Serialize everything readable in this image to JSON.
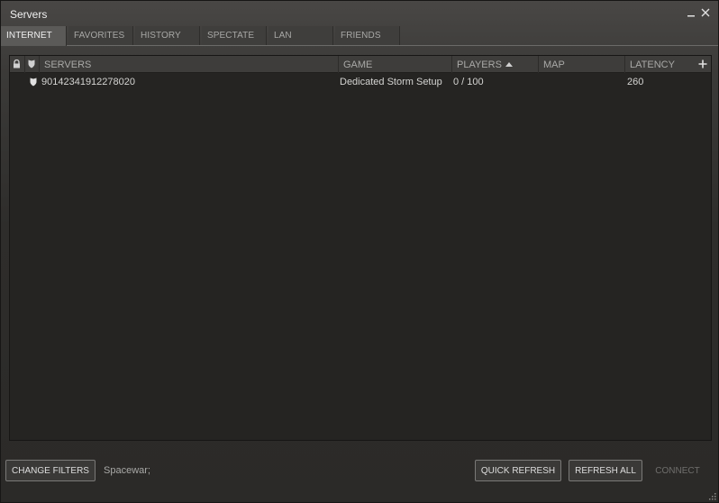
{
  "window": {
    "title": "Servers"
  },
  "tabs": [
    {
      "label": "INTERNET",
      "active": true
    },
    {
      "label": "FAVORITES",
      "active": false
    },
    {
      "label": "HISTORY",
      "active": false
    },
    {
      "label": "SPECTATE",
      "active": false
    },
    {
      "label": "LAN",
      "active": false
    },
    {
      "label": "FRIENDS",
      "active": false
    }
  ],
  "list": {
    "columns": {
      "servers": "SERVERS",
      "game": "GAME",
      "players": "PLAYERS",
      "map": "MAP",
      "latency": "LATENCY"
    },
    "sort_column": "players",
    "rows": [
      {
        "secure": true,
        "server": "90142341912278020",
        "game": "Dedicated Storm Setup",
        "players": "0 / 100",
        "map": "",
        "latency": "260"
      }
    ]
  },
  "footer": {
    "change_filters": "CHANGE FILTERS",
    "filter_summary": "Spacewar;",
    "quick_refresh": "QUICK REFRESH",
    "refresh_all": "REFRESH ALL",
    "connect": "CONNECT"
  },
  "colors": {
    "background": "#2b2a28",
    "list_background": "#252422",
    "active_tab": "#5b5a58",
    "disabled_text": "#6f6e6c"
  }
}
